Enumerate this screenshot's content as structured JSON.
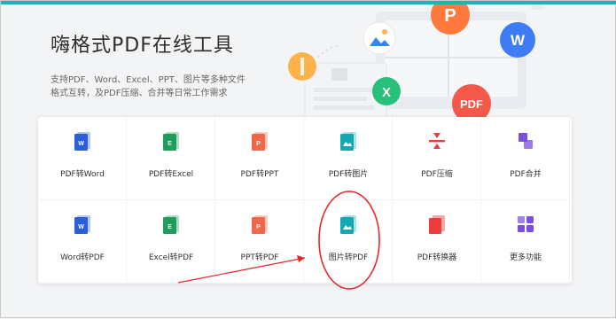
{
  "hero": {
    "title": "嗨格式PDF在线工具",
    "description": "支持PDF、Word、Excel、PPT、图片等多种文件格式互转，及PDF压缩、合并等日常工作需求",
    "bubbles": {
      "p": "P",
      "w": "W",
      "x": "X",
      "pdf": "PDF"
    }
  },
  "tools": [
    {
      "label": "PDF转Word",
      "icon": "word-doc-icon",
      "color": "#2b5fd9"
    },
    {
      "label": "PDF转Excel",
      "icon": "excel-doc-icon",
      "color": "#1e9e5a"
    },
    {
      "label": "PDF转PPT",
      "icon": "ppt-doc-icon",
      "color": "#f0674a"
    },
    {
      "label": "PDF转图片",
      "icon": "image-doc-icon",
      "color": "#13a9b1"
    },
    {
      "label": "PDF压缩",
      "icon": "compress-icon",
      "color": "#ee3b3b"
    },
    {
      "label": "PDF合并",
      "icon": "merge-icon",
      "color": "#7a4ee0"
    },
    {
      "label": "Word转PDF",
      "icon": "word-doc-icon",
      "color": "#2b5fd9"
    },
    {
      "label": "Excel转PDF",
      "icon": "excel-doc-icon",
      "color": "#1e9e5a"
    },
    {
      "label": "PPT转PDF",
      "icon": "ppt-doc-icon",
      "color": "#f0674a"
    },
    {
      "label": "图片转PDF",
      "icon": "image-doc-icon",
      "color": "#13a9b1"
    },
    {
      "label": "PDF转换器",
      "icon": "converter-icon",
      "color": "#ee3b3b"
    },
    {
      "label": "更多功能",
      "icon": "more-grid-icon",
      "color": "#7a4ee0"
    }
  ],
  "annotation": {
    "color": "#e8242a",
    "highlighted_tool": "图片转PDF"
  }
}
